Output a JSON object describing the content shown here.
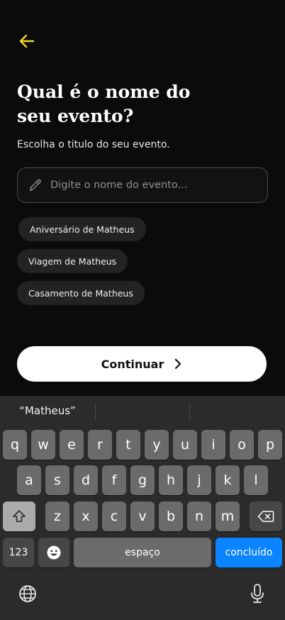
{
  "header": {
    "back_icon": "arrow-left-icon"
  },
  "title": "Qual é o nome do seu evento?",
  "subtitle": "Escolha o titulo do seu evento.",
  "input": {
    "placeholder": "Digite o nome do evento...",
    "value": "",
    "icon": "pencil-icon"
  },
  "suggestions": [
    "Aniversário de Matheus",
    "Viagem de Matheus",
    "Casamento de Matheus"
  ],
  "cta": {
    "label": "Continuar",
    "icon": "chevron-right-icon"
  },
  "keyboard": {
    "predictions": [
      "“Matheus”",
      "",
      ""
    ],
    "row1": [
      "q",
      "w",
      "e",
      "r",
      "t",
      "y",
      "u",
      "i",
      "o",
      "p"
    ],
    "row2": [
      "a",
      "s",
      "d",
      "f",
      "g",
      "h",
      "j",
      "k",
      "l"
    ],
    "row3": [
      "z",
      "x",
      "c",
      "v",
      "b",
      "n",
      "m"
    ],
    "numbers_key": "123",
    "emoji_icon": "emoji-icon",
    "space_label": "espaço",
    "done_label": "concluído",
    "shift_icon": "shift-icon",
    "delete_icon": "backspace-icon",
    "globe_icon": "globe-icon",
    "mic_icon": "microphone-icon"
  },
  "colors": {
    "accent": "#F5D62A",
    "background": "#0B0B0B",
    "chip": "#232323",
    "done_key": "#0A84FF"
  }
}
